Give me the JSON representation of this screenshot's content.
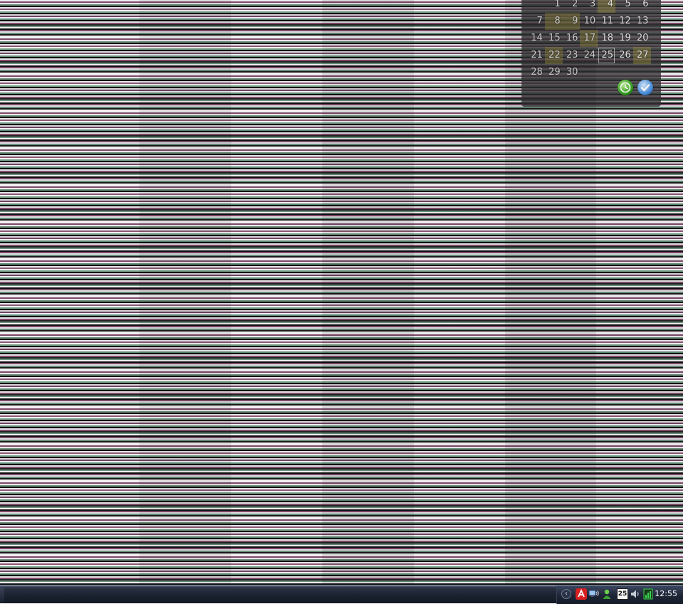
{
  "calendar": {
    "weeks": [
      [
        {
          "day": "",
          "hi": false
        },
        {
          "day": "1",
          "hi": false
        },
        {
          "day": "2",
          "hi": false
        },
        {
          "day": "3",
          "hi": false
        },
        {
          "day": "4",
          "hi": true
        },
        {
          "day": "5",
          "hi": false
        },
        {
          "day": "6",
          "hi": false
        }
      ],
      [
        {
          "day": "7",
          "hi": false
        },
        {
          "day": "8",
          "hi": true
        },
        {
          "day": "9",
          "hi": true
        },
        {
          "day": "10",
          "hi": false
        },
        {
          "day": "11",
          "hi": false
        },
        {
          "day": "12",
          "hi": false
        },
        {
          "day": "13",
          "hi": false
        }
      ],
      [
        {
          "day": "14",
          "hi": false
        },
        {
          "day": "15",
          "hi": false
        },
        {
          "day": "16",
          "hi": false
        },
        {
          "day": "17",
          "hi": true
        },
        {
          "day": "18",
          "hi": false
        },
        {
          "day": "19",
          "hi": false
        },
        {
          "day": "20",
          "hi": false
        }
      ],
      [
        {
          "day": "21",
          "hi": false
        },
        {
          "day": "22",
          "hi": true
        },
        {
          "day": "23",
          "hi": false
        },
        {
          "day": "24",
          "hi": false
        },
        {
          "day": "25",
          "hi": false,
          "today": true
        },
        {
          "day": "26",
          "hi": false
        },
        {
          "day": "27",
          "hi": true
        }
      ],
      [
        {
          "day": "28",
          "hi": false
        },
        {
          "day": "29",
          "hi": false
        },
        {
          "day": "30",
          "hi": false
        },
        {
          "day": "",
          "hi": false
        },
        {
          "day": "",
          "hi": false
        },
        {
          "day": "",
          "hi": false
        },
        {
          "day": "",
          "hi": false
        }
      ]
    ],
    "buttons": [
      {
        "name": "clock-button",
        "icon": "clock-icon",
        "color": "#32a020"
      },
      {
        "name": "tasks-button",
        "icon": "checkmark-icon",
        "color": "#4a90e0"
      }
    ]
  },
  "taskbar": {
    "tray": {
      "chevron_label": "‹",
      "date_badge": "25",
      "clock": "12:55",
      "icons": [
        "antivirus-icon",
        "network-icon",
        "user-icon",
        "calendar-icon",
        "volume-icon",
        "monitor-icon"
      ]
    }
  }
}
